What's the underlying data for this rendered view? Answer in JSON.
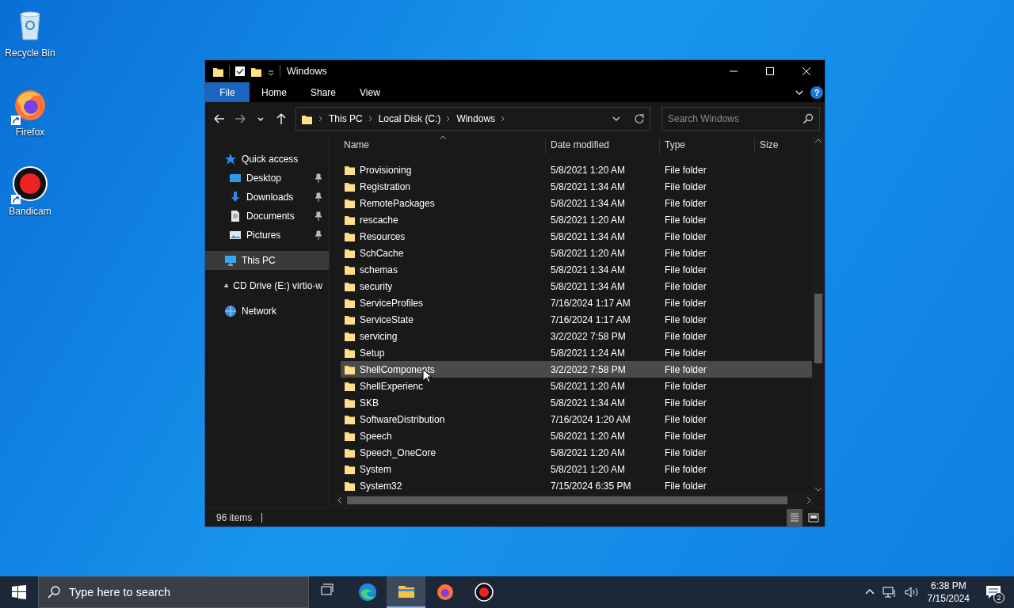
{
  "desktop_icons": [
    {
      "label": "Recycle Bin",
      "kind": "recycle",
      "shortcut": false
    },
    {
      "label": "Firefox",
      "kind": "firefox",
      "shortcut": true
    },
    {
      "label": "Bandicam",
      "kind": "record",
      "shortcut": true
    }
  ],
  "window": {
    "title": "Windows",
    "help_button": "?",
    "ribbon_tabs": [
      {
        "label": "File",
        "selected": true
      },
      {
        "label": "Home",
        "selected": false
      },
      {
        "label": "Share",
        "selected": false
      },
      {
        "label": "View",
        "selected": false
      }
    ],
    "breadcrumb": [
      "This PC",
      "Local Disk (C:)",
      "Windows"
    ],
    "search": {
      "placeholder": "Search Windows"
    },
    "nav": [
      {
        "label": "Quick access",
        "kind": "star",
        "selected": false,
        "children": [
          {
            "label": "Desktop",
            "kind": "desktop",
            "pinned": true,
            "selected": false
          },
          {
            "label": "Downloads",
            "kind": "download",
            "pinned": true,
            "selected": false
          },
          {
            "label": "Documents",
            "kind": "document",
            "pinned": true,
            "selected": false
          },
          {
            "label": "Pictures",
            "kind": "picture",
            "pinned": true,
            "selected": false
          }
        ]
      },
      {
        "label": "This PC",
        "kind": "pc",
        "selected": true
      },
      {
        "label": "CD Drive (E:) virtio-w",
        "kind": "cd",
        "selected": false
      },
      {
        "label": "Network",
        "kind": "network",
        "selected": false
      }
    ],
    "columns": [
      "Name",
      "Date modified",
      "Type",
      "Size"
    ],
    "rows": [
      {
        "name": "Provisioning",
        "date": "5/8/2021 1:20 AM",
        "type": "File folder",
        "highlighted": false
      },
      {
        "name": "Registration",
        "date": "5/8/2021 1:34 AM",
        "type": "File folder",
        "highlighted": false
      },
      {
        "name": "RemotePackages",
        "date": "5/8/2021 1:34 AM",
        "type": "File folder",
        "highlighted": false
      },
      {
        "name": "rescache",
        "date": "5/8/2021 1:20 AM",
        "type": "File folder",
        "highlighted": false
      },
      {
        "name": "Resources",
        "date": "5/8/2021 1:34 AM",
        "type": "File folder",
        "highlighted": false
      },
      {
        "name": "SchCache",
        "date": "5/8/2021 1:20 AM",
        "type": "File folder",
        "highlighted": false
      },
      {
        "name": "schemas",
        "date": "5/8/2021 1:34 AM",
        "type": "File folder",
        "highlighted": false
      },
      {
        "name": "security",
        "date": "5/8/2021 1:34 AM",
        "type": "File folder",
        "highlighted": false
      },
      {
        "name": "ServiceProfiles",
        "date": "7/16/2024 1:17 AM",
        "type": "File folder",
        "highlighted": false
      },
      {
        "name": "ServiceState",
        "date": "7/16/2024 1:17 AM",
        "type": "File folder",
        "highlighted": false
      },
      {
        "name": "servicing",
        "date": "3/2/2022 7:58 PM",
        "type": "File folder",
        "highlighted": false
      },
      {
        "name": "Setup",
        "date": "5/8/2021 1:24 AM",
        "type": "File folder",
        "highlighted": false
      },
      {
        "name": "ShellComponents",
        "date": "3/2/2022 7:58 PM",
        "type": "File folder",
        "highlighted": true
      },
      {
        "name": "ShellExperienc",
        "date": "5/8/2021 1:20 AM",
        "type": "File folder",
        "highlighted": false
      },
      {
        "name": "SKB",
        "date": "5/8/2021 1:34 AM",
        "type": "File folder",
        "highlighted": false
      },
      {
        "name": "SoftwareDistribution",
        "date": "7/16/2024 1:20 AM",
        "type": "File folder",
        "highlighted": false
      },
      {
        "name": "Speech",
        "date": "5/8/2021 1:20 AM",
        "type": "File folder",
        "highlighted": false
      },
      {
        "name": "Speech_OneCore",
        "date": "5/8/2021 1:20 AM",
        "type": "File folder",
        "highlighted": false
      },
      {
        "name": "System",
        "date": "5/8/2021 1:20 AM",
        "type": "File folder",
        "highlighted": false
      },
      {
        "name": "System32",
        "date": "7/15/2024 6:35 PM",
        "type": "File folder",
        "highlighted": false
      }
    ],
    "status_bar": {
      "item_count": "96 items"
    }
  },
  "taskbar": {
    "search_placeholder": "Type here to search",
    "apps": [
      {
        "kind": "taskview",
        "active": false
      },
      {
        "kind": "edge",
        "active": false
      },
      {
        "kind": "explorer",
        "active": true
      },
      {
        "kind": "firefox",
        "active": false
      },
      {
        "kind": "record",
        "active": false
      }
    ],
    "time": "6:38 PM",
    "date": "7/15/2024",
    "notification_count": "2"
  }
}
